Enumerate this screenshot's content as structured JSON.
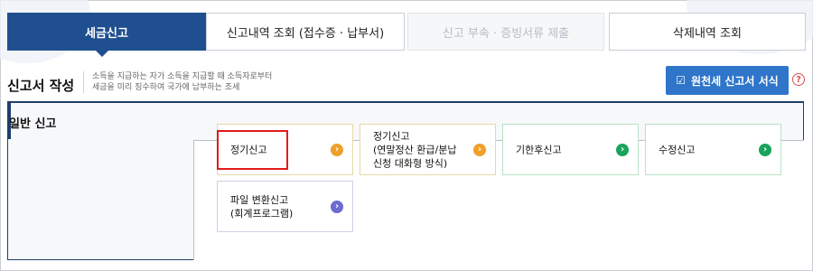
{
  "tabs": [
    {
      "label": "세금신고",
      "state": "active"
    },
    {
      "label": "신고내역 조회 (접수증 · 납부서)",
      "state": "normal"
    },
    {
      "label": "신고 부속 · 증빙서류 제출",
      "state": "disabled"
    },
    {
      "label": "삭제내역 조회",
      "state": "normal"
    }
  ],
  "header": {
    "title": "신고서 작성",
    "desc_line1": "소득을 지급하는 자가 소득을 지급할 때 소득자로부터",
    "desc_line2": "세금을 미리 징수하여 국가에 납부하는 조세",
    "form_button": "원천세 신고서 서식",
    "help": "?"
  },
  "panel": {
    "label": "일반 신고"
  },
  "cards": [
    {
      "lines": [
        "정기신고"
      ],
      "arrow": "orange",
      "highlighted": true
    },
    {
      "lines": [
        "정기신고",
        "(연말정산 환급/분납",
        "신청 대화형 방식)"
      ],
      "arrow": "orange"
    },
    {
      "lines": [
        "기한후신고"
      ],
      "arrow": "green"
    },
    {
      "lines": [
        "수정신고"
      ],
      "arrow": "green"
    },
    {
      "lines": [
        "파일 변환신고",
        "(회계프로그램)"
      ],
      "arrow": "purple"
    }
  ],
  "colors": {
    "primary": "#1f4f8f",
    "button": "#2f75c9",
    "orange_arrow": "#f0a02a",
    "green_arrow": "#1aa35c",
    "purple_arrow": "#6b6bd1",
    "highlight": "#e21b1b"
  },
  "icons": {
    "form_button": "document-edit-icon",
    "arrows": "chevron-right-icon"
  }
}
